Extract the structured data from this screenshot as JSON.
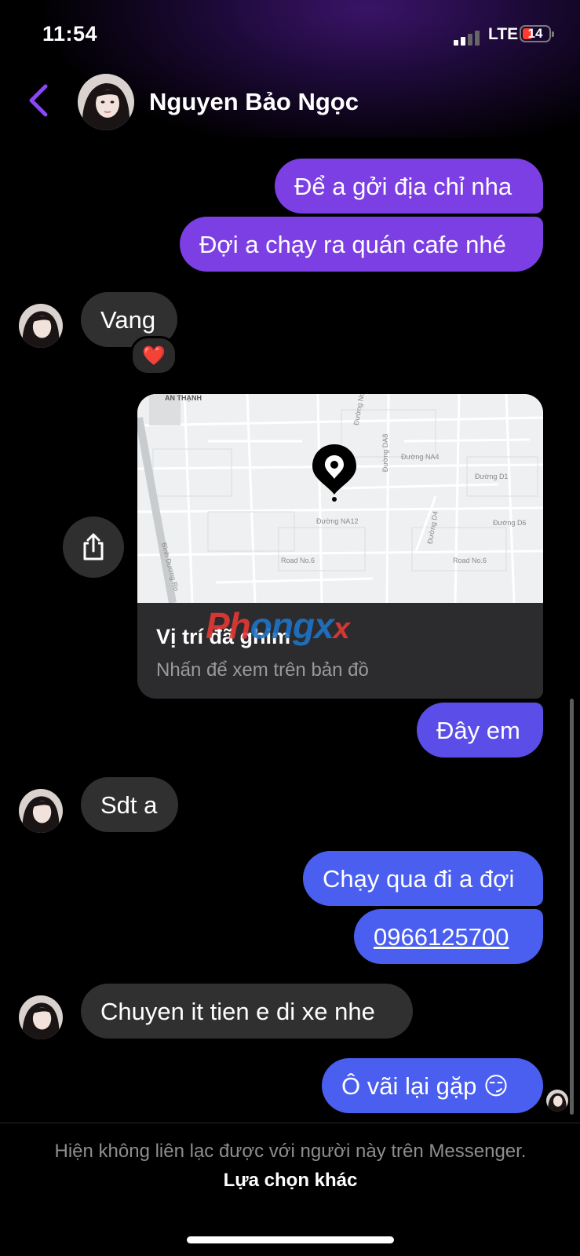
{
  "status_bar": {
    "time": "11:54",
    "network": "LTE",
    "battery": "14"
  },
  "header": {
    "contact_name": "Nguyen Bảo Ngọc",
    "back_icon": "chevron-left-icon",
    "accent": "#8b45ff"
  },
  "messages": [
    {
      "id": 1,
      "direction": "out",
      "text": "Để a gởi địa chỉ nha"
    },
    {
      "id": 2,
      "direction": "out",
      "text": "Đợi a chạy ra quán cafe nhé"
    },
    {
      "id": 3,
      "direction": "in",
      "text": "Vang",
      "reaction": "❤️"
    },
    {
      "id": 4,
      "direction": "out",
      "type": "location"
    },
    {
      "id": 5,
      "direction": "out",
      "text": "Đây em"
    },
    {
      "id": 6,
      "direction": "in",
      "text": "Sdt a"
    },
    {
      "id": 7,
      "direction": "out",
      "text": "Chạy qua đi a đợi"
    },
    {
      "id": 8,
      "direction": "out",
      "text": "0966125700",
      "link": true
    },
    {
      "id": 9,
      "direction": "in",
      "text": "Chuyen it tien e di xe nhe"
    },
    {
      "id": 10,
      "direction": "out",
      "text": "Ô vãi lại gặp 😏"
    }
  ],
  "location_card": {
    "title": "Vị trí đã ghim",
    "subtitle": "Nhấn để xem trên bản đồ",
    "map_labels": [
      "AN THẠNH",
      "Đường NA4",
      "Đường D1",
      "Đường NA12",
      "Đường D6",
      "Road No.6",
      "Road No.6",
      "Đường DA8",
      "Đường D4",
      "Bình Dương Ro",
      "Đường No.1"
    ]
  },
  "watermark": {
    "part1": "Ph",
    "part2": "ongx",
    "part3": "x"
  },
  "footer": {
    "text": "Hiện không liên lạc được với người này trên Messenger.",
    "action": "Lựa chọn khác"
  },
  "colors": {
    "outgoing_purple": "#7b3fe4",
    "outgoing_blue": "#4a5fef",
    "incoming": "#303030",
    "background": "#000000"
  }
}
